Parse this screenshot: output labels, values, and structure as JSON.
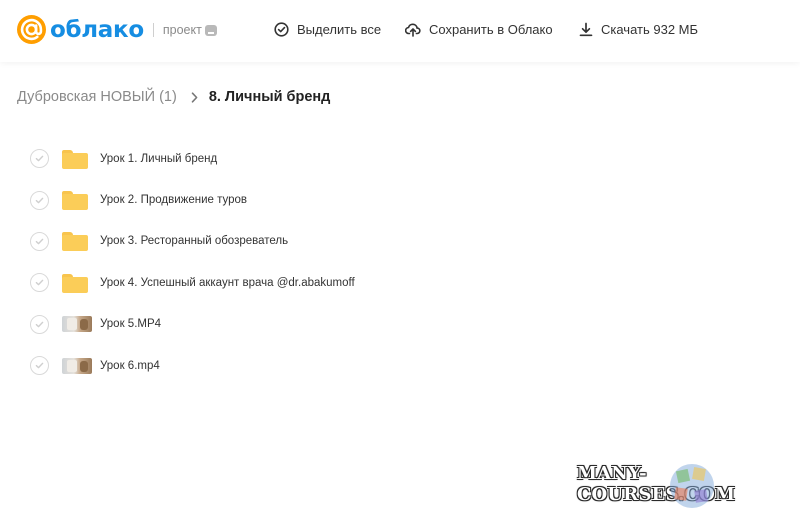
{
  "header": {
    "brand": "облако",
    "project_label": "проект",
    "select_all": "Выделить все",
    "save_to_cloud": "Сохранить в Облако",
    "download": "Скачать 932 МБ"
  },
  "breadcrumb": {
    "parent": "Дубровская НОВЫЙ (1)",
    "current": "8. Личный бренд"
  },
  "files": [
    {
      "name": "Урок 1. Личный бренд",
      "type": "folder"
    },
    {
      "name": "Урок 2. Продвижение туров",
      "type": "folder"
    },
    {
      "name": "Урок 3. Ресторанный обозреватель",
      "type": "folder"
    },
    {
      "name": "Урок 4. Успешный аккаунт врача @dr.abakumoff",
      "type": "folder"
    },
    {
      "name": "Урок 5.MP4",
      "type": "video"
    },
    {
      "name": "Урок 6.mp4",
      "type": "video"
    }
  ],
  "watermark": "MANY-COURSES.COM",
  "colors": {
    "brand_orange": "#ff9e00",
    "brand_blue": "#168de2",
    "folder_yellow": "#fbcd58"
  }
}
